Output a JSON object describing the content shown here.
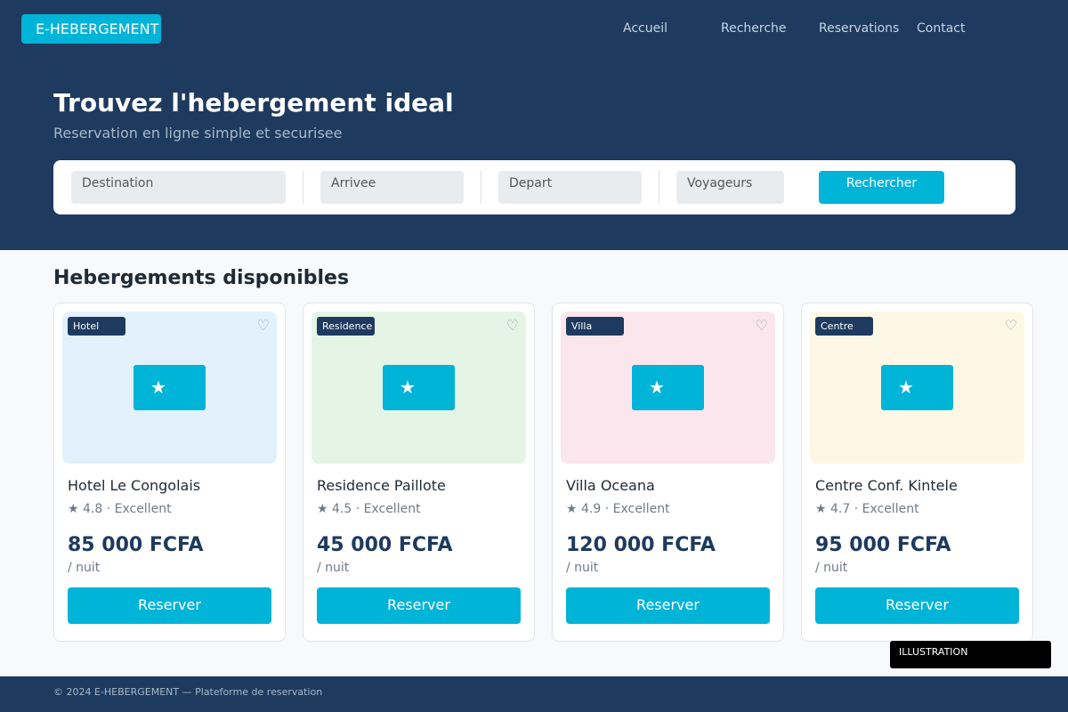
{
  "header": {
    "logo": "E-HEBERGEMENT",
    "nav": [
      "Accueil",
      "Recherche",
      "Reservations",
      "Contact"
    ]
  },
  "hero": {
    "title": "Trouvez l'hebergement ideal",
    "subtitle": "Reservation en ligne simple et securisee"
  },
  "search": {
    "destination": "Destination",
    "arrival": "Arrivee",
    "departure": "Depart",
    "travelers": "Voyageurs",
    "button": "Rechercher"
  },
  "listings": {
    "title": "Hebergements disponibles",
    "cards": [
      {
        "tag": "Hotel",
        "name": "Hotel Le Congolais",
        "rating": "★ 4.8 · Excellent",
        "price": "85 000 FCFA",
        "unit": "/ nuit",
        "button": "Reserver",
        "image_bg": "#e3f1fc"
      },
      {
        "tag": "Residence",
        "name": "Residence Paillote",
        "rating": "★ 4.5 · Excellent",
        "price": "45 000 FCFA",
        "unit": "/ nuit",
        "button": "Reserver",
        "image_bg": "#e4f5e6"
      },
      {
        "tag": "Villa",
        "name": "Villa Oceana",
        "rating": "★ 4.9 · Excellent",
        "price": "120 000 FCFA",
        "unit": "/ nuit",
        "button": "Reserver",
        "image_bg": "#fce6ee"
      },
      {
        "tag": "Centre",
        "name": "Centre Conf. Kintele",
        "rating": "★ 4.7 · Excellent",
        "price": "95 000 FCFA",
        "unit": "/ nuit",
        "button": "Reserver",
        "image_bg": "#fef7e6"
      }
    ]
  },
  "icons": {
    "favorite": "heart-outline-icon",
    "image": "star-icon"
  },
  "illustration_label": "ILLUSTRATION",
  "footer": {
    "text": "© 2024 E-HEBERGEMENT — Plateforme de reservation"
  },
  "colors": {
    "primary": "#1e3a5f",
    "accent": "#00b4d8",
    "background": "#f7f9fb"
  }
}
